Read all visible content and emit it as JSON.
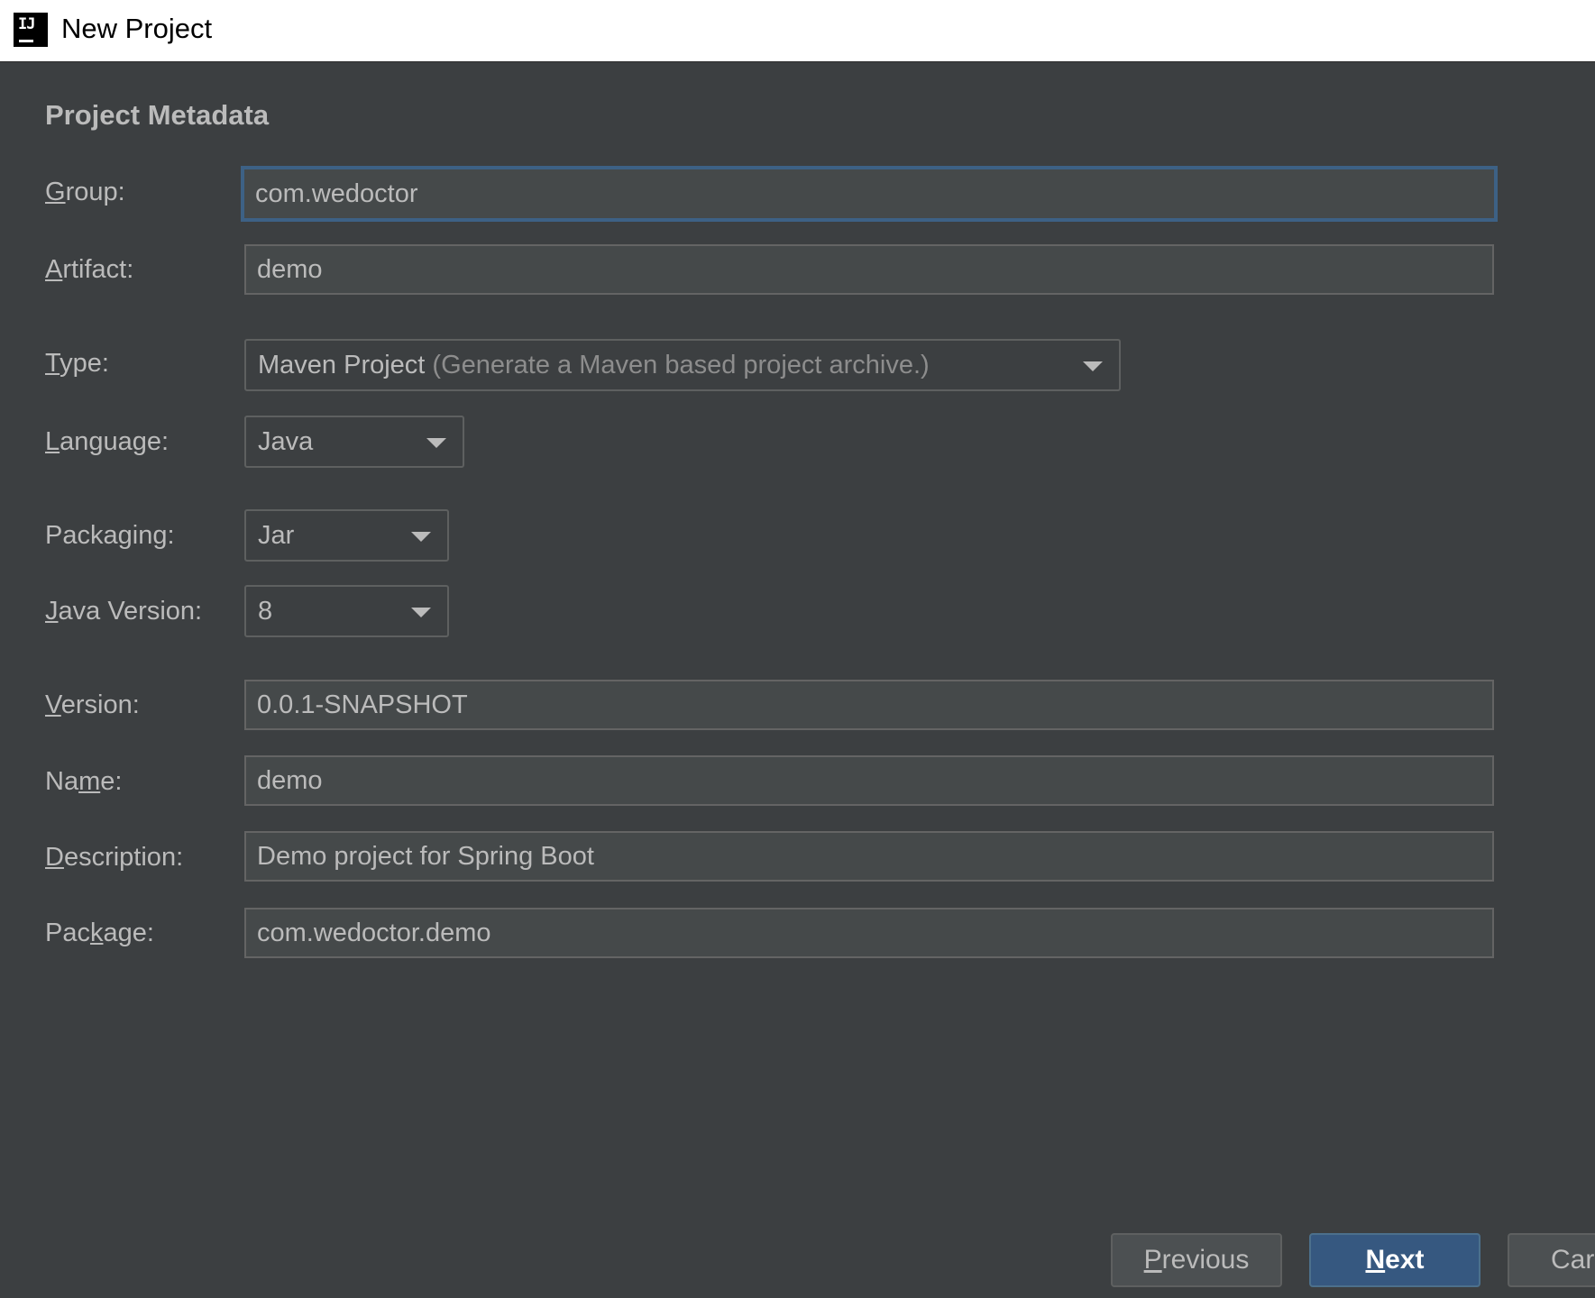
{
  "window": {
    "icon_text": "IJ",
    "title": "New Project"
  },
  "form": {
    "section_title": "Project Metadata",
    "group": {
      "label_mnemonic": "G",
      "label_rest": "roup:",
      "value": "com.wedoctor"
    },
    "artifact": {
      "label_mnemonic": "A",
      "label_rest": "rtifact:",
      "value": "demo"
    },
    "type": {
      "label_mnemonic": "T",
      "label_rest": "ype:",
      "value": "Maven Project",
      "hint": " (Generate a Maven based project archive.)"
    },
    "language": {
      "label_mnemonic": "L",
      "label_rest": "anguage:",
      "value": "Java"
    },
    "packaging": {
      "label_pre": "Packa",
      "label_mnemonic": "g",
      "label_post": "ing:",
      "value": "Jar"
    },
    "java_version": {
      "label_mnemonic": "J",
      "label_rest": "ava Version:",
      "value": "8"
    },
    "version": {
      "label_mnemonic": "V",
      "label_rest": "ersion:",
      "value": "0.0.1-SNAPSHOT"
    },
    "name": {
      "label_pre": "Na",
      "label_mnemonic": "m",
      "label_post": "e:",
      "value": "demo"
    },
    "description": {
      "label_mnemonic": "D",
      "label_rest": "escription:",
      "value": "Demo project for Spring Boot"
    },
    "package": {
      "label_pre": "Pac",
      "label_mnemonic": "k",
      "label_post": "age:",
      "value": "com.wedoctor.demo"
    }
  },
  "buttons": {
    "previous": {
      "mnemonic": "P",
      "rest": "revious"
    },
    "next": {
      "mnemonic": "N",
      "rest": "ext"
    },
    "cancel": {
      "label": "Car"
    }
  },
  "colors": {
    "background": "#3c3f41",
    "field_background": "#45494a",
    "focus_border": "#3d6185",
    "primary_button": "#365880",
    "text": "#bbbbbb"
  }
}
